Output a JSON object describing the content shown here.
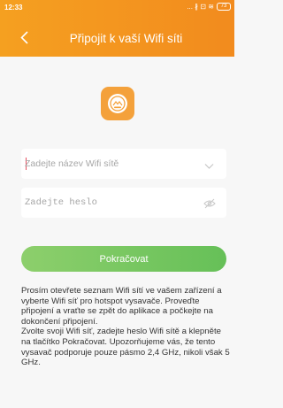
{
  "status": {
    "time": "12:33",
    "icons_text": "... ∦ ⊡ ≋",
    "battery": "73"
  },
  "header": {
    "title": "Připojit k vaší Wifi síti"
  },
  "form": {
    "ssid_placeholder": "Zadejte název Wifi sítě",
    "password_placeholder": "Zadejte heslo",
    "continue_label": "Pokračovat"
  },
  "info": {
    "paragraph1": "Prosím otevřete seznam Wifi sítí ve vašem zařízení a vyberte Wifi síť pro hotspot vysavače. Proveďte připojení a vraťte se zpět do aplikace a počkejte na dokončení připojení.",
    "paragraph2": "Zvolte svoji Wifi síť, zadejte heslo Wifi sítě a klepněte na tlačítko Pokračovat. Upozorňujeme vás, že tento vysavač podporuje pouze pásmo 2,4 GHz, nikoli však 5 GHz."
  },
  "colors": {
    "header": "#f39520",
    "button": "#73c45e",
    "logo": "#f4a13b"
  }
}
